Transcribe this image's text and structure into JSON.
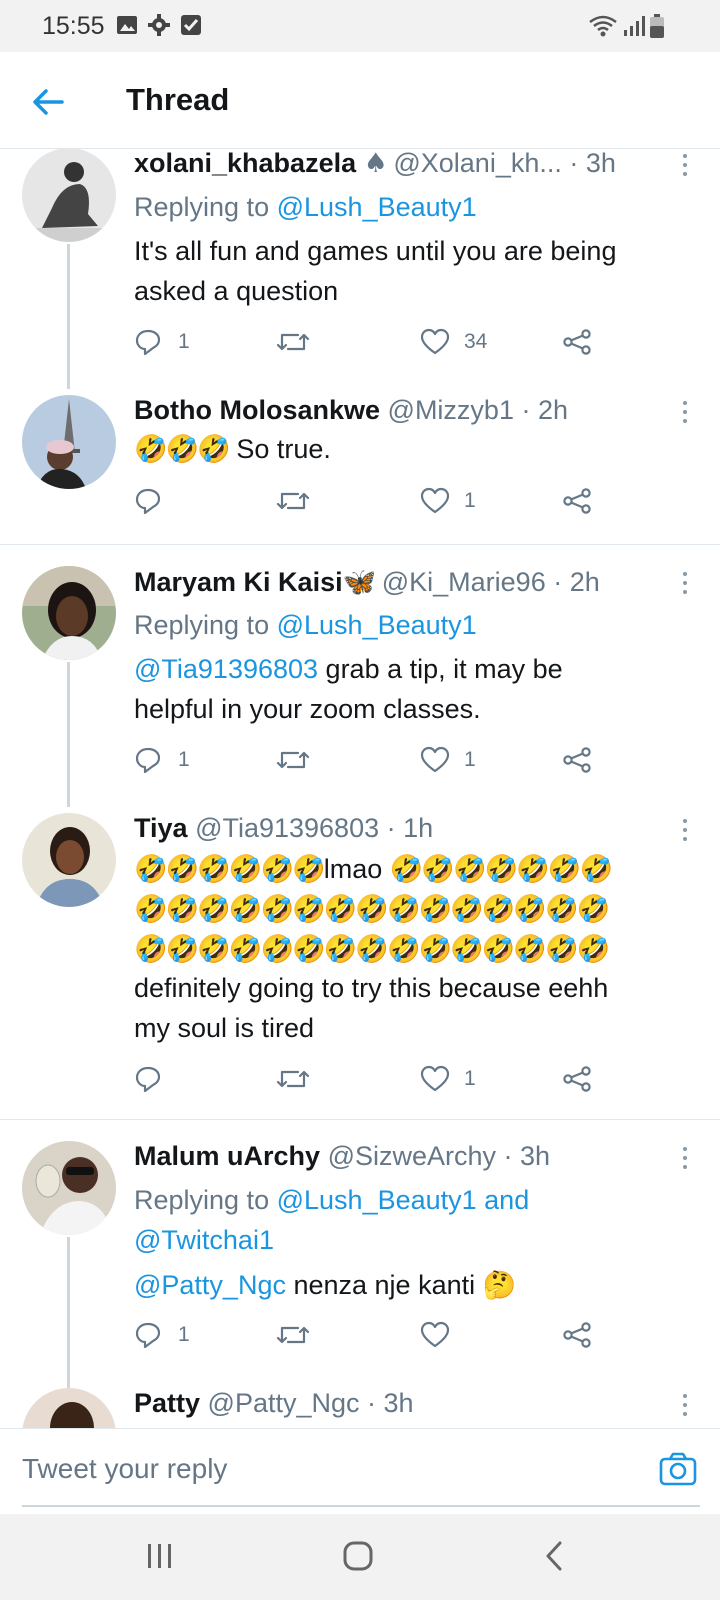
{
  "status_bar": {
    "time": "15:55"
  },
  "header": {
    "title": "Thread"
  },
  "tweets": [
    {
      "name": "xolani_khabazela",
      "name_suffix": "♠",
      "handle": "@Xolani_kh...",
      "time": "· 3h",
      "replying_prefix": "Replying to",
      "replying_to": "@Lush_Beauty1",
      "text_lines": [
        "It's all fun and games until you are being",
        "asked a question"
      ],
      "replies": "1",
      "likes": "34"
    },
    {
      "name": "Botho Molosankwe",
      "handle": "@Mizzyb1",
      "time": "· 2h",
      "emojis": "🤣🤣🤣",
      "text": "So true.",
      "likes": "1"
    },
    {
      "name": "Maryam Ki Kaisi",
      "name_suffix": "🦋",
      "handle": "@Ki_Marie96",
      "time": "· 2h",
      "replying_prefix": "Replying to",
      "replying_to": "@Lush_Beauty1",
      "mention": "@Tia91396803",
      "text_line1": " grab a tip, it may be",
      "text_line2": "helpful in your zoom classes.",
      "replies": "1",
      "likes": "1"
    },
    {
      "name": "Tiya",
      "handle": "@Tia91396803",
      "time": "· 1h",
      "emoji_line1_a": "🤣🤣🤣🤣🤣🤣",
      "text_lmao": "lmao",
      "emoji_line1_b": "🤣🤣🤣🤣🤣🤣🤣",
      "emoji_line2": "🤣🤣🤣🤣🤣🤣🤣🤣🤣🤣🤣🤣🤣🤣🤣",
      "emoji_line3": "🤣🤣🤣🤣🤣🤣🤣🤣🤣🤣🤣🤣🤣🤣🤣",
      "text_lines": [
        "definitely going to try this because eehh",
        "my soul is tired"
      ],
      "likes": "1"
    },
    {
      "name": "Malum uArchy",
      "handle": "@SizweArchy",
      "time": "· 3h",
      "replying_prefix": "Replying to",
      "replying_to": "@Lush_Beauty1 and",
      "replying_to_2": "@Twitchai1",
      "mention": "@Patty_Ngc",
      "text": " nenza nje kanti ",
      "emoji": "🤔",
      "replies": "1"
    },
    {
      "name": "Patty",
      "handle": "@Patty_Ngc",
      "time": "· 3h"
    }
  ],
  "reply_bar": {
    "placeholder": "Tweet your reply"
  },
  "icons": {
    "back": "arrow-left-icon",
    "reply": "speech-bubble-icon",
    "retweet": "retweet-icon",
    "like": "heart-icon",
    "share": "share-icon",
    "camera": "camera-icon"
  },
  "colors": {
    "accent": "#1b95e0",
    "text": "#14171a",
    "secondary": "#657786",
    "line": "#ccd6dd"
  }
}
